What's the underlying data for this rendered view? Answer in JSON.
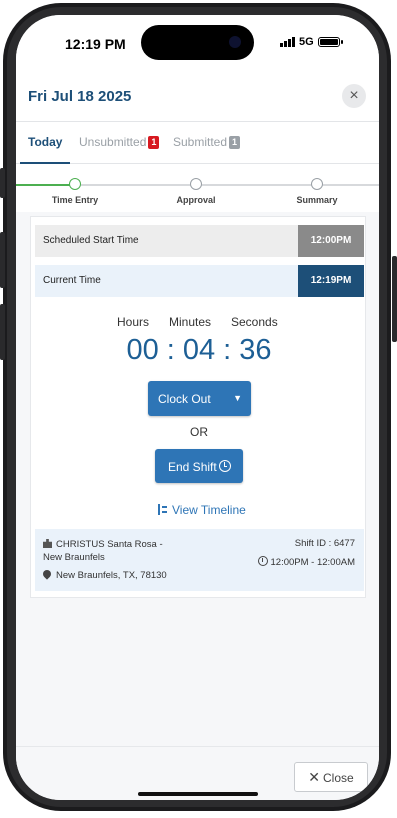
{
  "status_bar": {
    "time": "12:19 PM",
    "network": "5G"
  },
  "header": {
    "date_title": "Fri Jul 18 2025",
    "close_glyph": "×"
  },
  "tabs": [
    {
      "label": "Today",
      "active": true
    },
    {
      "label": "Unsubmitted",
      "count": "1",
      "badge_color": "#d71920"
    },
    {
      "label": "Submitted",
      "count": "1",
      "badge_color": "#9aa0a6"
    }
  ],
  "stepper": {
    "steps": [
      {
        "label": "Time Entry",
        "state": "current"
      },
      {
        "label": "Approval",
        "state": "pending"
      },
      {
        "label": "Summary",
        "state": "pending"
      }
    ],
    "progress_color": "#4caf50"
  },
  "schedule": {
    "scheduled_label": "Scheduled Start Time",
    "scheduled_value": "12:00PM",
    "current_label": "Current Time",
    "current_value": "12:19PM"
  },
  "timer": {
    "hours_label": "Hours",
    "minutes_label": "Minutes",
    "seconds_label": "Seconds",
    "display": "00 : 04 : 36"
  },
  "actions": {
    "clock_out_label": "Clock Out",
    "or_text": "OR",
    "end_shift_label": "End Shift",
    "view_timeline_label": "View Timeline"
  },
  "shift_info": {
    "facility": "CHRISTUS Santa Rosa - New Braunfels",
    "location": "New Braunfels, TX, 78130",
    "shift_id": "Shift ID : 6477",
    "shift_time": "12:00PM - 12:00AM"
  },
  "footer": {
    "close_label": "Close"
  },
  "colors": {
    "brand_blue": "#1d4f78",
    "button_blue": "#2e75b6",
    "scheduled_bg": "#8a8a8a",
    "current_bg": "#1d4f78"
  }
}
